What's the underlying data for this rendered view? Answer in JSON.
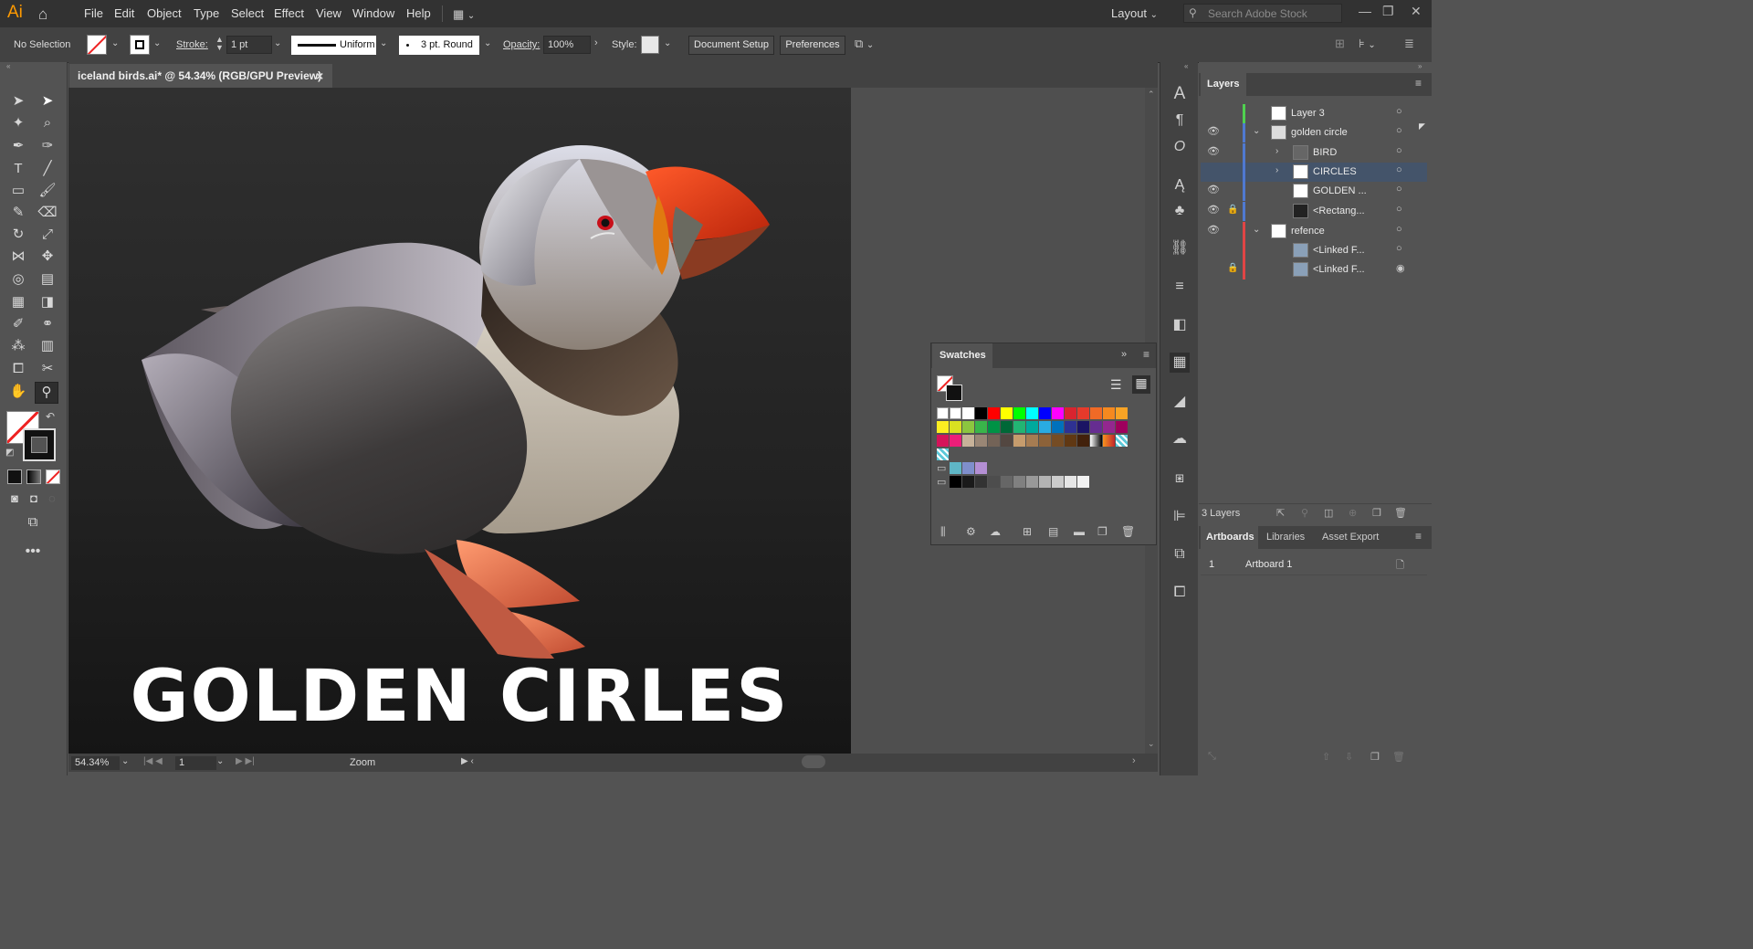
{
  "app": {
    "logo": "Ai",
    "workspace": "Layout",
    "search_placeholder": "Search Adobe Stock"
  },
  "menu": [
    "File",
    "Edit",
    "Object",
    "Type",
    "Select",
    "Effect",
    "View",
    "Window",
    "Help"
  ],
  "control": {
    "selection": "No Selection",
    "stroke_label": "Stroke:",
    "stroke_weight": "1 pt",
    "profile": "Uniform",
    "brush": "3 pt. Round",
    "opacity_label": "Opacity:",
    "opacity": "100%",
    "style_label": "Style:",
    "doc_setup": "Document Setup",
    "preferences": "Preferences"
  },
  "document": {
    "tab_title": "iceland birds.ai* @ 54.34% (RGB/GPU Preview)",
    "close": "×"
  },
  "artwork": {
    "headline": "GOLDEN CIRLES"
  },
  "status": {
    "zoom": "54.34%",
    "artboard_num": "1",
    "tool": "Zoom"
  },
  "layers_panel": {
    "title": "Layers",
    "rows": [
      {
        "name": "Layer 3",
        "color": "#4fd14f"
      },
      {
        "name": "golden circle",
        "color": "#4f79d1"
      },
      {
        "name": "BIRD",
        "color": "#4f79d1"
      },
      {
        "name": "CIRCLES",
        "color": "#4f79d1"
      },
      {
        "name": "GOLDEN ...",
        "color": "#4f79d1"
      },
      {
        "name": "<Rectang...",
        "color": "#4f79d1"
      },
      {
        "name": "refence",
        "color": "#e04545"
      },
      {
        "name": "<Linked F...",
        "color": "#e04545"
      },
      {
        "name": "<Linked F...",
        "color": "#e04545"
      }
    ],
    "count": "3 Layers"
  },
  "artboards_panel": {
    "tabs": [
      "Artboards",
      "Libraries",
      "Asset Export"
    ],
    "rows": [
      {
        "num": "1",
        "name": "Artboard 1"
      }
    ]
  },
  "swatches_panel": {
    "title": "Swatches"
  }
}
